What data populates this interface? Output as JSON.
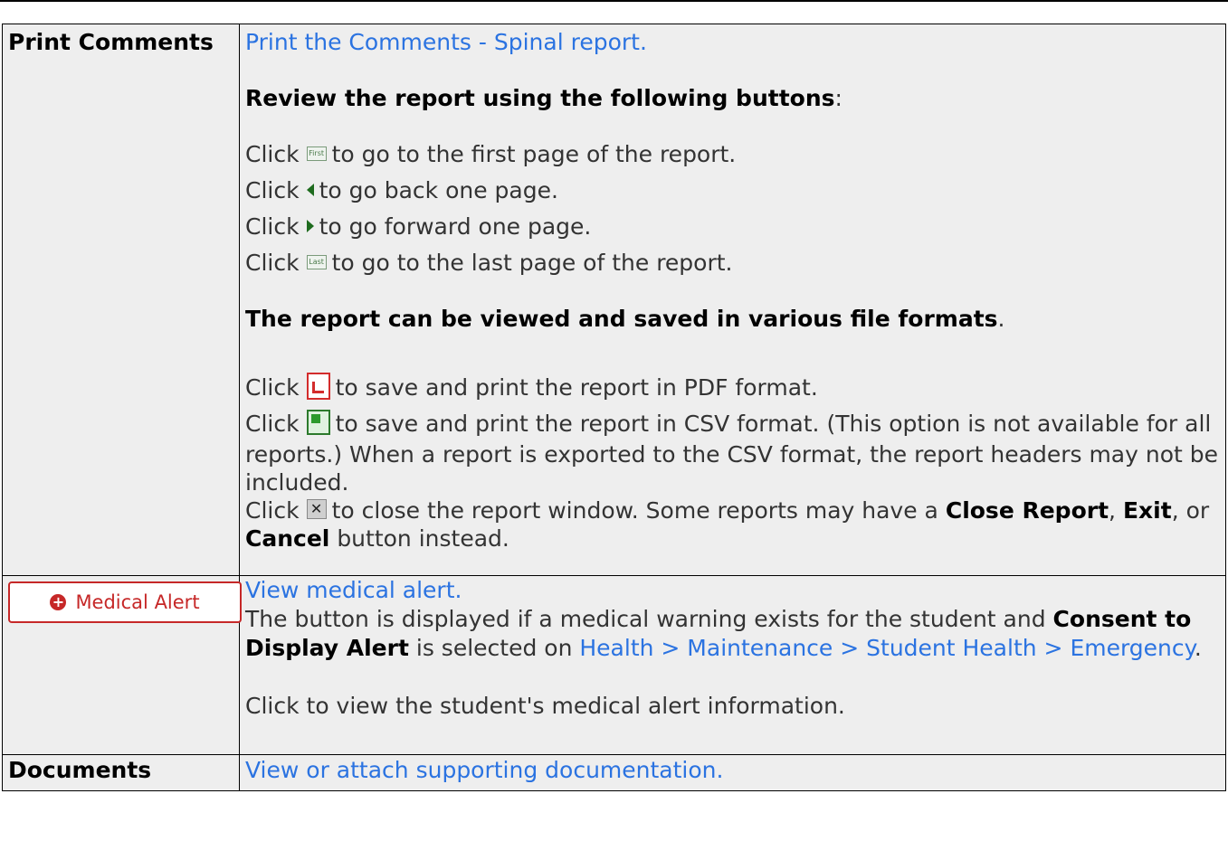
{
  "row1": {
    "header": "Print Comments",
    "link": "Print the Comments - Spinal report.",
    "review_heading": "Review the report using the following buttons",
    "review_colon": ":",
    "click": "Click",
    "first_label": "First",
    "last_label": "Last",
    "first_text": "to go to the first page of the report.",
    "back_text": "to go back one page.",
    "forward_text": "to go forward one page.",
    "last_text": "to go to the last page of the report.",
    "formats_heading": "The report can be viewed and saved in various file formats",
    "formats_period": ".",
    "pdf_text": "to save and print the report in PDF format.",
    "csv_text": "to save and print the report in CSV format. (This option is not available for all reports.) When a report is exported to the CSV format, the report headers may not be included.",
    "close_text": "to close the report window. Some reports may have a",
    "close_report": "Close Report",
    "comma1": ",",
    "exit": "Exit",
    "comma_or": ", or",
    "cancel": "Cancel",
    "button_instead": "button instead."
  },
  "row2": {
    "button_label": "Medical Alert",
    "link": "View medical alert.",
    "desc_start": "The button is displayed if a medical warning exists for the student and",
    "consent": "Consent to Display Alert",
    "selected_on": "is selected on",
    "path_link": "Health > Maintenance > Student Health > Emergency",
    "period": ".",
    "click_text": "Click to view the student's medical alert information."
  },
  "row3": {
    "header": "Documents",
    "link": "View or attach supporting documentation."
  },
  "colors": {
    "link": "#2b73e1",
    "cell_bg": "#eeeeee",
    "alert_red": "#c62828"
  },
  "icons": [
    "first-page-icon",
    "previous-page-icon",
    "next-page-icon",
    "last-page-icon",
    "pdf-icon",
    "csv-icon",
    "close-icon",
    "plus-circle-icon"
  ]
}
